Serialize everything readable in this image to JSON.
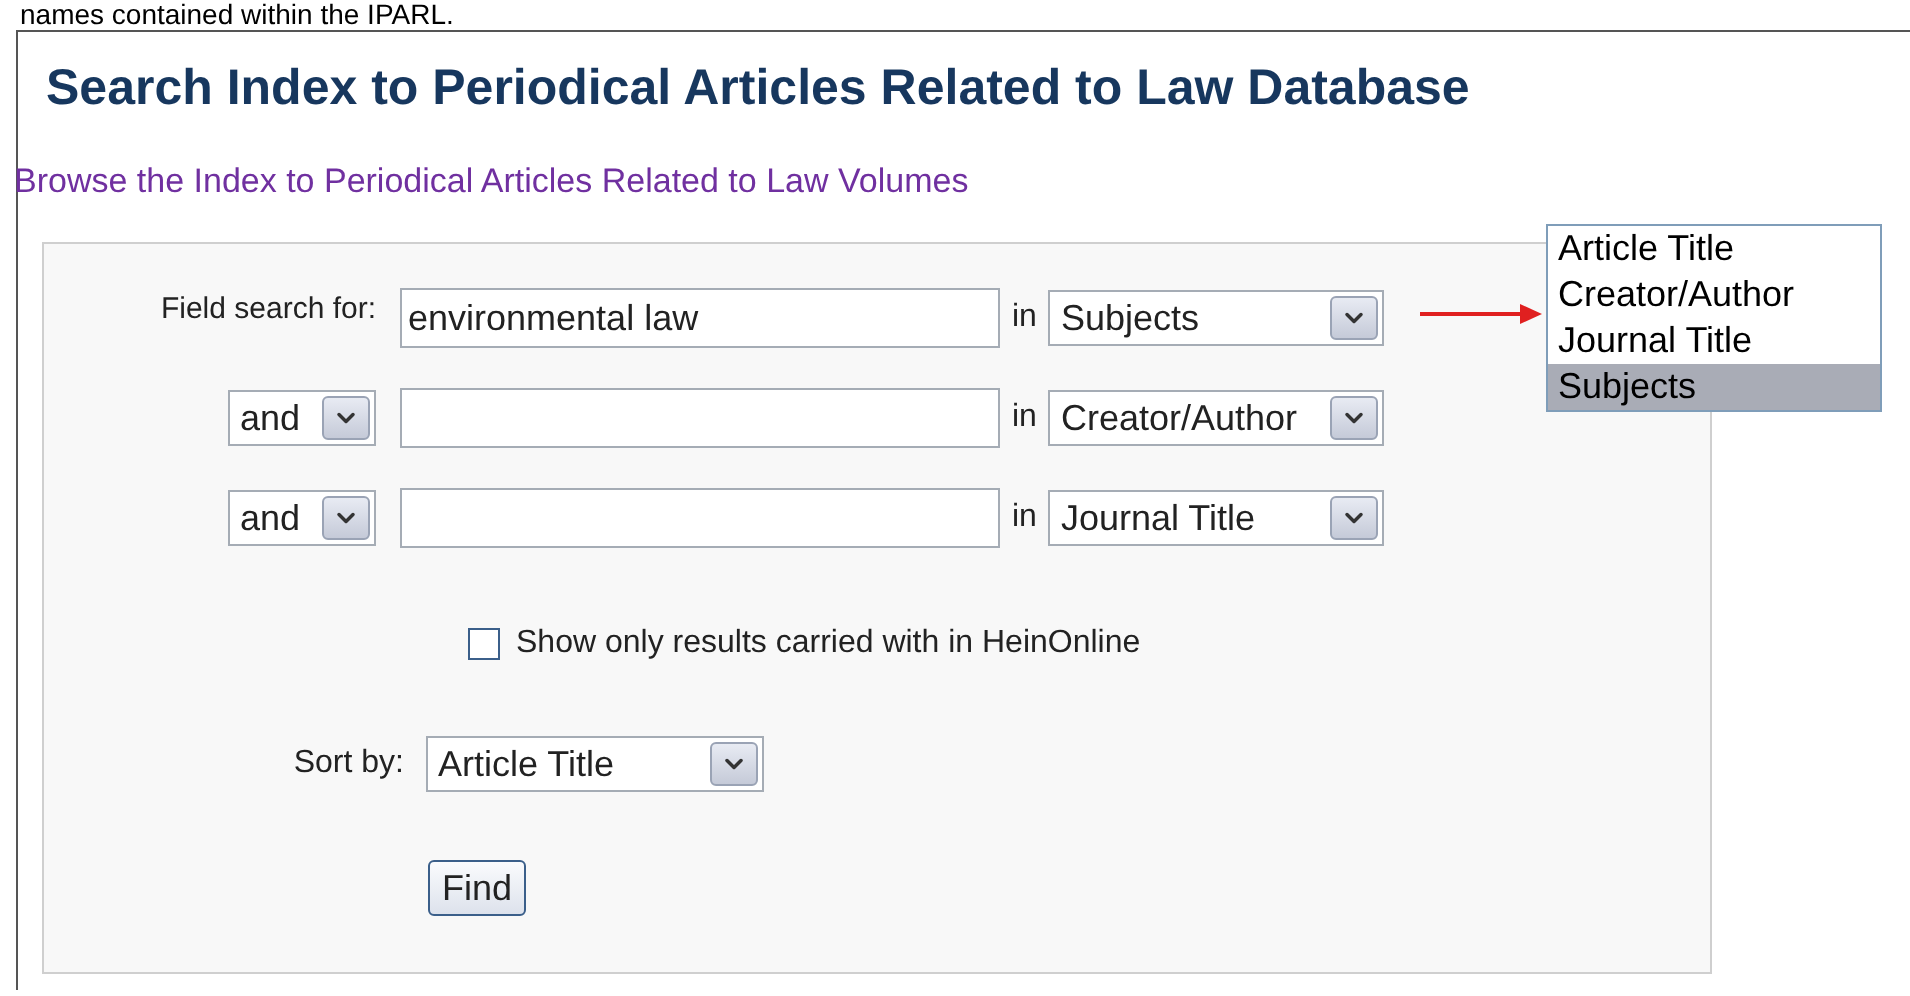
{
  "intro_text": "names contained within the IPARL.",
  "title": "Search Index to Periodical Articles Related to Law Database",
  "browse_link": "Browse the Index to Periodical Articles Related to Law Volumes",
  "search_rows": [
    {
      "kind": "first",
      "label": "Field search for:",
      "value": "environmental law",
      "in_label": "in",
      "field": "Subjects"
    },
    {
      "kind": "operator",
      "operator": "and",
      "in_label": "in",
      "field": "Creator/Author"
    },
    {
      "kind": "operator",
      "operator": "and",
      "in_label": "in",
      "field": "Journal Title"
    }
  ],
  "field_options": [
    {
      "label": "Article Title",
      "selected": false
    },
    {
      "label": "Creator/Author",
      "selected": false
    },
    {
      "label": "Journal Title",
      "selected": false
    },
    {
      "label": "Subjects",
      "selected": true
    }
  ],
  "holdings_checkbox": {
    "label": "Show only results carried with in HeinOnline",
    "checked": false
  },
  "sort": {
    "label": "Sort by:",
    "value": "Article Title"
  },
  "find_button": "Find"
}
